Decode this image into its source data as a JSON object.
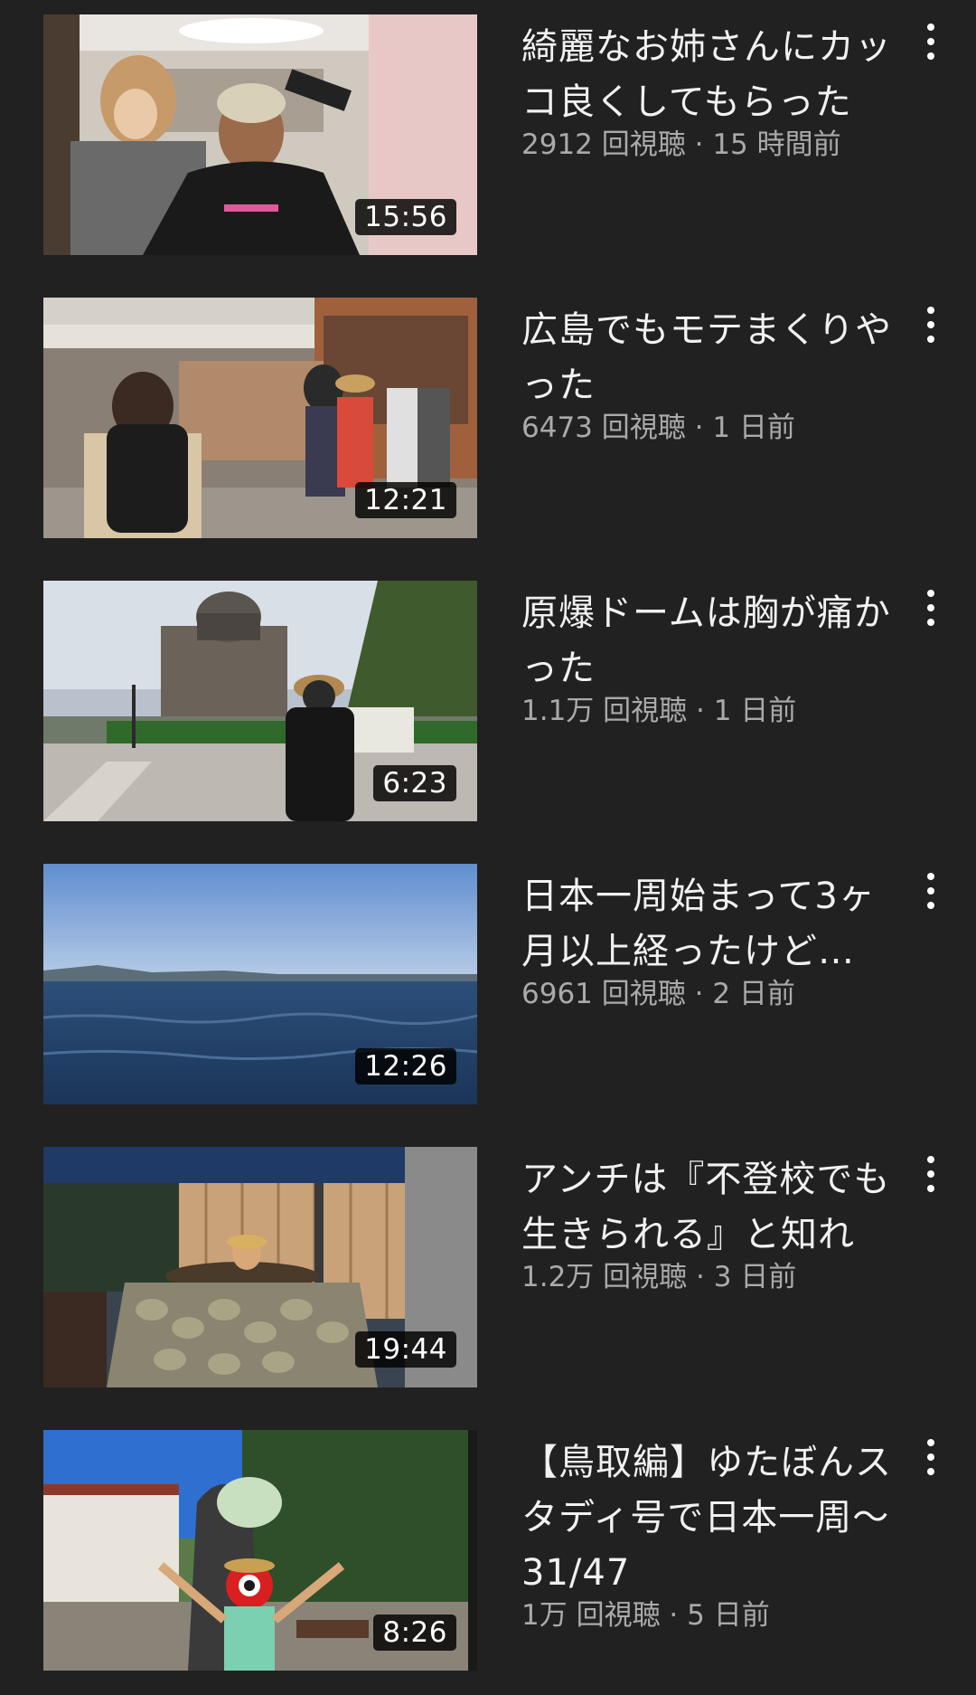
{
  "videos": [
    {
      "title": "綺麗なお姉さんにカッコ良くしてもらった",
      "views": "2912 回視聴",
      "age": "15 時間前",
      "duration": "15:56",
      "thumb_icon": "salon-haircut-thumbnail"
    },
    {
      "title": "広島でもモテまくりやった",
      "views": "6473 回視聴",
      "age": "1 日前",
      "duration": "12:21",
      "thumb_icon": "street-shopping-thumbnail"
    },
    {
      "title": "原爆ドームは胸が痛かった",
      "views": "1.1万 回視聴",
      "age": "1 日前",
      "duration": "6:23",
      "thumb_icon": "atomic-dome-thumbnail"
    },
    {
      "title": "日本一周始まって3ヶ月以上経ったけど…",
      "views": "6961 回視聴",
      "age": "2 日前",
      "duration": "12:26",
      "thumb_icon": "sea-view-thumbnail"
    },
    {
      "title": "アンチは『不登校でも生きられる』と知れ",
      "views": "1.2万 回視聴",
      "age": "3 日前",
      "duration": "19:44",
      "thumb_icon": "outdoor-bath-thumbnail"
    },
    {
      "title": "【鳥取編】ゆたぼんスタディ号で日本一周〜31/47",
      "views": "1万 回視聴",
      "age": "5 日前",
      "duration": "8:26",
      "thumb_icon": "tottori-statue-thumbnail"
    }
  ],
  "meta_separator": " · ",
  "menu_icon": "more-vertical-icon",
  "colors": {
    "background": "#212121",
    "title": "#f1f1f1",
    "meta": "#aaaaaa",
    "duration_bg": "#000000"
  }
}
